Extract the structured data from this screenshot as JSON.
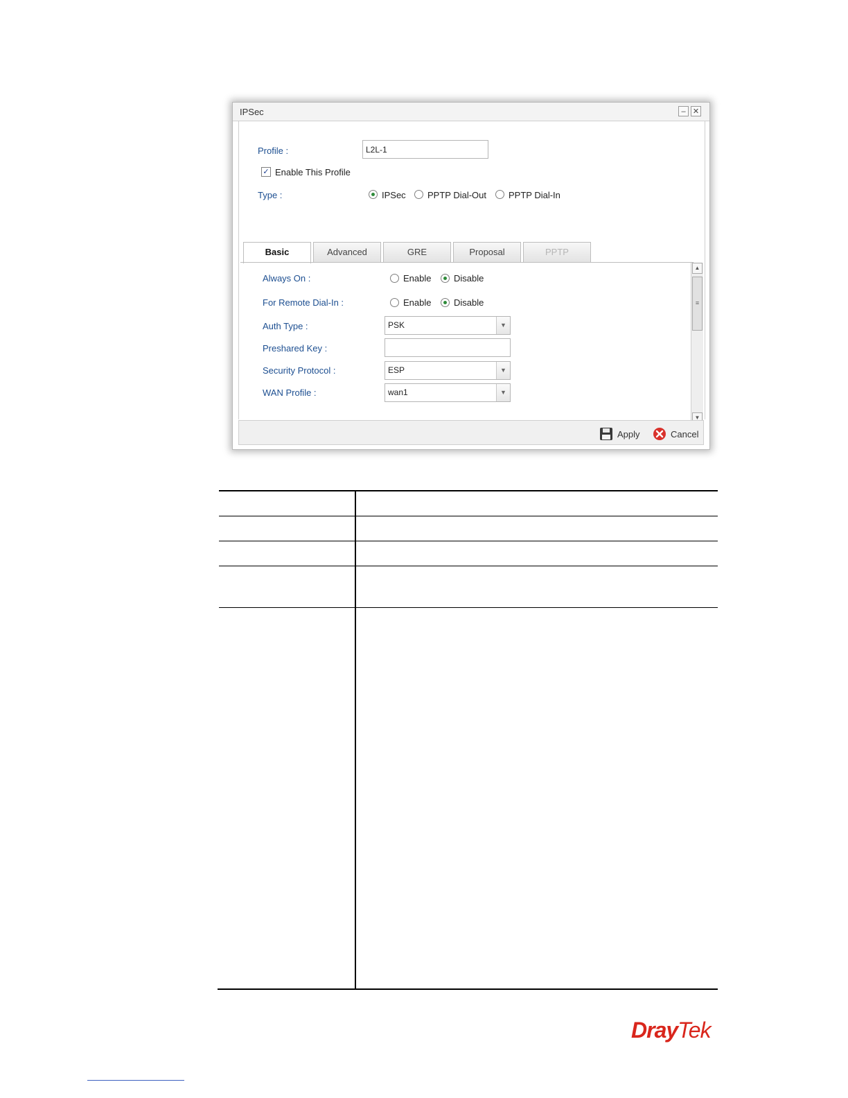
{
  "dialog": {
    "title": "IPSec",
    "minimize_icon": "minimize-icon",
    "close_icon": "close-icon",
    "profile_label": "Profile :",
    "profile_value": "L2L-1",
    "enable_profile_label": "Enable This Profile",
    "enable_profile_checked": true,
    "type_label": "Type :",
    "type_options": [
      "IPSec",
      "PPTP Dial-Out",
      "PPTP Dial-In"
    ],
    "type_selected": "IPSec"
  },
  "tabs": [
    {
      "label": "Basic",
      "state": "active"
    },
    {
      "label": "Advanced",
      "state": "normal"
    },
    {
      "label": "GRE",
      "state": "normal"
    },
    {
      "label": "Proposal",
      "state": "normal"
    },
    {
      "label": "PPTP",
      "state": "disabled"
    }
  ],
  "basic": {
    "always_on_label": "Always On :",
    "always_on_enable": "Enable",
    "always_on_disable": "Disable",
    "always_on_selected": "Disable",
    "remote_dialin_label": "For Remote Dial-In :",
    "remote_dialin_enable": "Enable",
    "remote_dialin_disable": "Disable",
    "remote_dialin_selected": "Disable",
    "auth_type_label": "Auth Type :",
    "auth_type_value": "PSK",
    "preshared_key_label": "Preshared Key :",
    "preshared_key_value": "",
    "security_protocol_label": "Security Protocol :",
    "security_protocol_value": "ESP",
    "wan_profile_label": "WAN Profile :",
    "wan_profile_value": "wan1"
  },
  "footer": {
    "apply_label": "Apply",
    "cancel_label": "Cancel",
    "apply_icon": "save-icon",
    "cancel_icon": "cancel-icon"
  },
  "brand": {
    "part1": "Dray",
    "part2": "Tek",
    "color": "#d9261c"
  },
  "colors": {
    "label_blue": "#1d4f91",
    "radio_green": "#2e8b3a"
  }
}
